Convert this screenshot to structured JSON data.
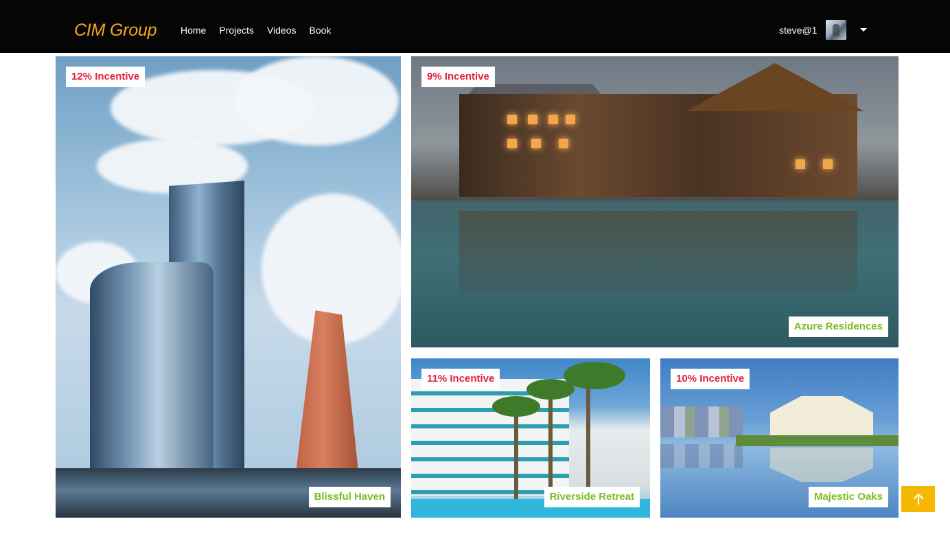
{
  "header": {
    "brand": "CIM Group",
    "nav": [
      "Home",
      "Projects",
      "Videos",
      "Book"
    ],
    "username": "steve@1",
    "avatar_icon": "user-avatar",
    "dropdown_icon": "caret-down-icon"
  },
  "properties": [
    {
      "incentive": "12% Incentive",
      "name": "Blissful Haven"
    },
    {
      "incentive": "9% Incentive",
      "name": "Azure Residences"
    },
    {
      "incentive": "11% Incentive",
      "name": "Riverside Retreat"
    },
    {
      "incentive": "10% Incentive",
      "name": "Majestic Oaks"
    }
  ],
  "scroll_top_icon": "arrow-up-icon",
  "colors": {
    "header_bg": "#050505",
    "brand": "#f4a51c",
    "incentive_text": "#e0213c",
    "name_text": "#7cbb22",
    "scroll_button": "#f5b800"
  }
}
